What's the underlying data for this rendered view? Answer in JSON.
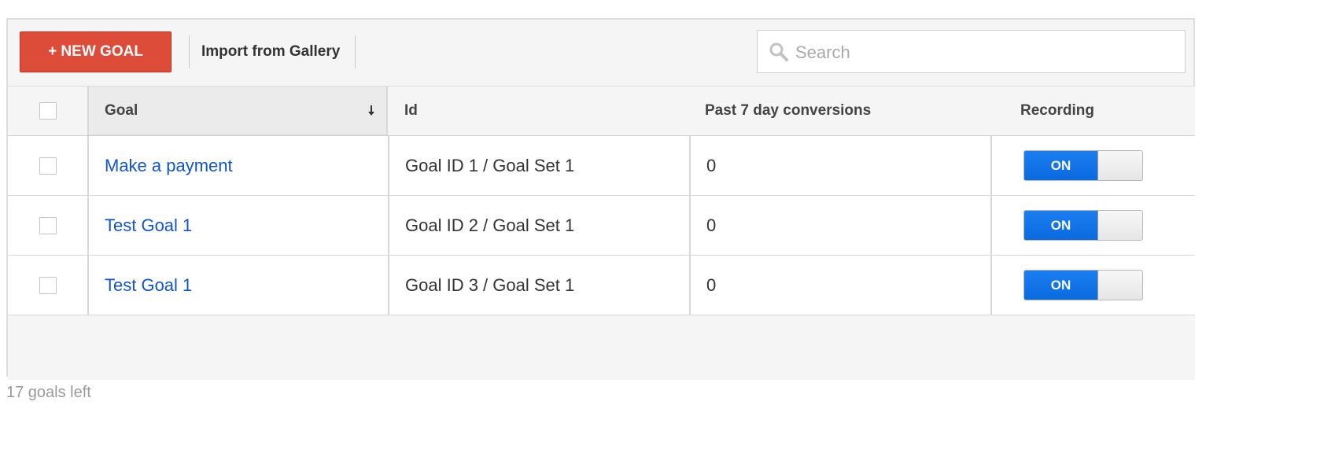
{
  "toolbar": {
    "new_goal_label": "+ NEW GOAL",
    "import_label": "Import from Gallery",
    "search_placeholder": "Search"
  },
  "table": {
    "headers": {
      "goal": "Goal",
      "id": "Id",
      "conversions": "Past 7 day conversions",
      "recording": "Recording"
    },
    "sort": {
      "column": "goal",
      "direction": "descending",
      "icon": "sort-down-arrow-icon"
    },
    "rows": [
      {
        "goal": "Make a payment",
        "id": "Goal ID 1 / Goal Set 1",
        "conversions": "0",
        "recording": "ON"
      },
      {
        "goal": "Test Goal 1",
        "id": "Goal ID 2 / Goal Set 1",
        "conversions": "0",
        "recording": "ON"
      },
      {
        "goal": "Test Goal 1",
        "id": "Goal ID 3 / Goal Set 1",
        "conversions": "0",
        "recording": "ON"
      }
    ]
  },
  "footer": {
    "goals_left": "17 goals left"
  },
  "colors": {
    "new_goal_button": "#dd4b39",
    "link": "#1155cc",
    "toggle_on": "#1a73e8",
    "panel_bg": "#f5f5f5"
  }
}
